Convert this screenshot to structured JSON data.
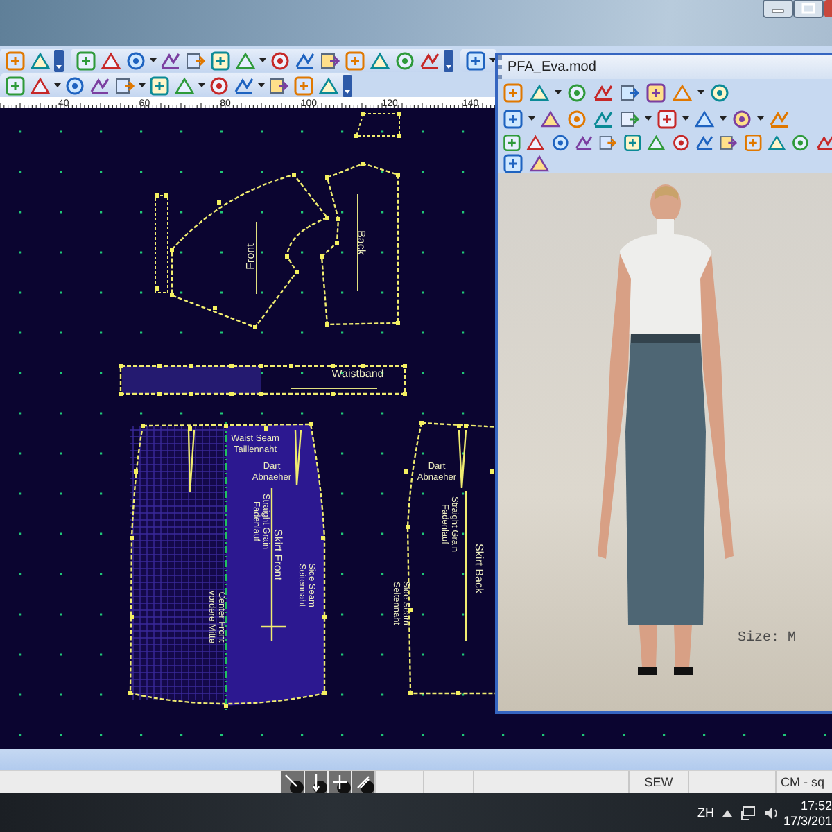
{
  "ruler": {
    "ticks": [
      "40",
      "60",
      "80",
      "100",
      "120",
      "140"
    ]
  },
  "pattern_pieces": [
    {
      "labels": [
        "Front"
      ]
    },
    {
      "labels": [
        "Back"
      ]
    },
    {
      "labels": [
        "Waistband"
      ]
    },
    {
      "labels": [
        "Waist Seam",
        "Taillennaht",
        "Dart",
        "Abnaeher",
        "Straight Grain",
        "Fadenlauf",
        "Skirt Front",
        "Side Seam",
        "Seitennaht",
        "Center Front",
        "vordere Mitte"
      ]
    },
    {
      "labels": [
        "Dart",
        "Abnaeher",
        "Straight Grain",
        "Fadenlauf",
        "Skirt Back",
        "Side Seam",
        "Seitennaht"
      ]
    }
  ],
  "model_window": {
    "title": "PFA_Eva.mod",
    "size_label": "Size: M"
  },
  "status_bar": {
    "panels": [
      "SEW",
      "CM - sq"
    ]
  },
  "taskbar": {
    "language": "ZH",
    "time": "17:52",
    "date": "17/3/201"
  }
}
